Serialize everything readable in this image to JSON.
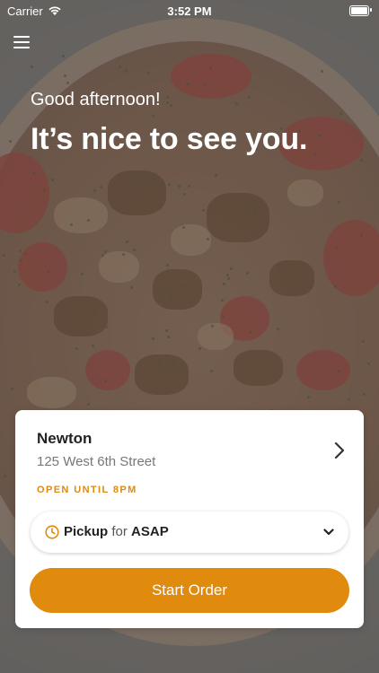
{
  "status_bar": {
    "carrier": "Carrier",
    "time": "3:52 PM",
    "battery_level": 1.0,
    "wifi_icon": "wifi-icon",
    "battery_icon": "battery-icon"
  },
  "header": {
    "menu_icon": "hamburger-menu-icon",
    "greeting": "Good afternoon!",
    "headline": "It’s nice to see you."
  },
  "store_card": {
    "store_name": "Newton",
    "store_address": "125 West 6th Street",
    "hours_status": "OPEN UNTIL 8PM",
    "chevron_icon": "chevron-right-icon",
    "pickup": {
      "mode": "Pickup",
      "connector": "for",
      "time": "ASAP",
      "clock_icon": "clock-icon",
      "dropdown_icon": "chevron-down-icon"
    },
    "start_button_label": "Start Order"
  },
  "colors": {
    "accent": "#e08a0e",
    "card_background": "#ffffff",
    "text_primary": "#222222",
    "text_secondary": "#777777",
    "overlay_text": "#ffffff"
  },
  "background_image": "pizza"
}
